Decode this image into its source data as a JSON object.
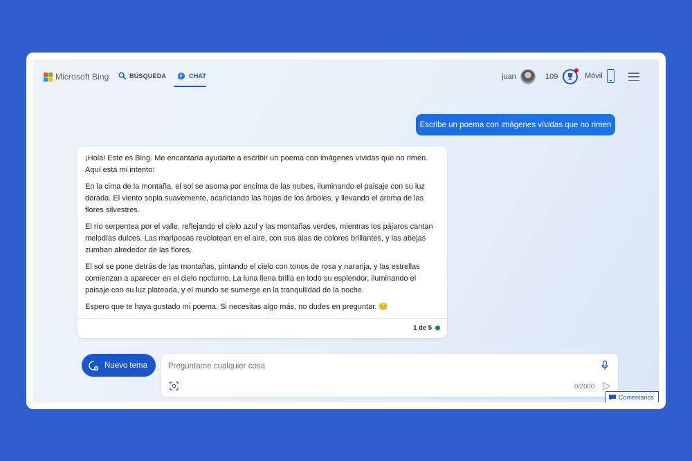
{
  "header": {
    "logo_text": "Microsoft Bing",
    "tabs": [
      {
        "label": "BÚSQUEDA",
        "icon": "search-icon"
      },
      {
        "label": "CHAT",
        "icon": "chat-bubble-icon"
      }
    ],
    "user_name": "juan",
    "points": "109",
    "mobile_label": "Móvil"
  },
  "conversation": {
    "user_message": "Escribe un poema con imágenes vívidas que no rimen",
    "bot_paragraphs": [
      "¡Hola! Este es Bing. Me encantaría ayudarte a escribir un poema con imágenes vívidas que no rimen. Aquí está mi intento:",
      "En la cima de la montaña, el sol se asoma por encima de las nubes, iluminando el paisaje con su luz dorada. El viento sopla suavemente, acariciando las hojas de los árboles, y llevando el aroma de las flores silvestres.",
      "El río serpentea por el valle, reflejando el cielo azul y las montañas verdes, mientras los pájaros cantan melodías dulces. Las mariposas revolotean en el aire, con sus alas de colores brillantes, y las abejas zumban alrededor de las flores.",
      "El sol se pone detrás de las montañas, pintando el cielo con tonos de rosa y naranja, y las estrellas comienzan a aparecer en el cielo nocturno. La luna llena brilla en todo su esplendor, iluminando el paisaje con su luz plateada, y el mundo se sumerge en la tranquilidad de la noche.",
      "Espero que te haya gustado mi poema. Si necesitas algo más, no dudes en preguntar. 😊"
    ],
    "page_indicator": "1 de 5"
  },
  "composer": {
    "new_topic_label": "Nuevo tema",
    "placeholder": "Pregúntame cualquier cosa",
    "char_count": "0/2000"
  },
  "feedback_label": "Comentarios",
  "colors": {
    "background": "#2f5fcf",
    "accent": "#1a56c9",
    "user_bubble": "#1a73e8",
    "status_dot": "#0f8a3c"
  }
}
